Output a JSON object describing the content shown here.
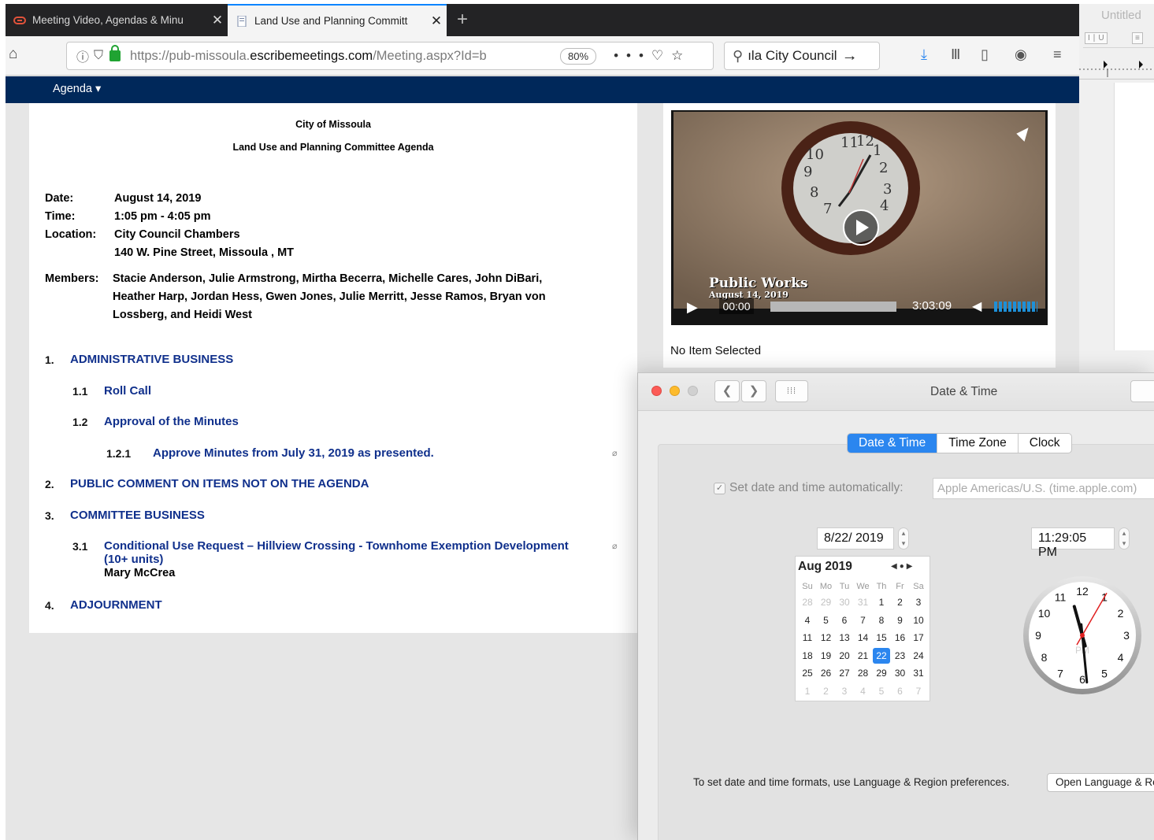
{
  "browser": {
    "tabs": [
      {
        "label": "Meeting Video, Agendas & Minu",
        "active": false
      },
      {
        "label": "Land Use and Planning Committ",
        "active": true
      }
    ],
    "url_prefix": "https://pub-missoula.",
    "url_domain": "escribemeetings.com",
    "url_suffix": "/Meeting.aspx?Id=b",
    "zoom": "80%",
    "search_text": "ıla City Council"
  },
  "site": {
    "menu_label": "Agenda ▾"
  },
  "agenda": {
    "org": "City of Missoula",
    "title": "Land Use and Planning Committee Agenda",
    "date_label": "Date:",
    "date_value": "August 14, 2019",
    "time_label": "Time:",
    "time_value": "1:05 pm - 4:05 pm",
    "location_label": "Location:",
    "location_line1": "City Council Chambers",
    "location_line2": "140 W. Pine Street, Missoula , MT",
    "members_label": "Members:",
    "members_line1": "Stacie Anderson, Julie Armstrong, Mirtha Becerra, Michelle Cares, John DiBari,",
    "members_line2": "Heather Harp, Jordan Hess, Gwen Jones, Julie Merritt, Jesse Ramos, Bryan von",
    "members_line3": "Lossberg, and Heidi West",
    "items": {
      "n1": "1.",
      "t1": "ADMINISTRATIVE BUSINESS",
      "n11": "1.1",
      "t11": "Roll Call",
      "n12": "1.2",
      "t12": "Approval of the Minutes",
      "n121": "1.2.1",
      "t121": "Approve Minutes from July 31, 2019 as presented.",
      "n2": "2.",
      "t2": "PUBLIC COMMENT ON ITEMS NOT ON THE AGENDA",
      "n3": "3.",
      "t3": "COMMITTEE BUSINESS",
      "n31": "3.1",
      "t31a": "Conditional Use Request – Hillview Crossing - Townhome Exemption Development",
      "t31b": "(10+ units)",
      "t31presenter": "Mary McCrea",
      "n4": "4.",
      "t4": "ADJOURNMENT"
    }
  },
  "video": {
    "overlay_title": "Public Works",
    "overlay_date": "August 14, 2019",
    "current_time": "00:00",
    "duration": "3:03:09",
    "progress": 0.0,
    "no_item": "No Item Selected"
  },
  "background_window": {
    "title": "Untitled"
  },
  "datetime": {
    "window_title": "Date & Time",
    "tabs": [
      "Date & Time",
      "Time Zone",
      "Clock"
    ],
    "active_tab": "Date & Time",
    "auto_label": "Set date and time automatically:",
    "auto_checked": true,
    "server": "Apple Americas/U.S. (time.apple.com)",
    "date_field": "8/22/ 2019",
    "time_field": "11:29:05 PM",
    "calendar": {
      "month_label": "Aug 2019",
      "dow": [
        "Su",
        "Mo",
        "Tu",
        "We",
        "Th",
        "Fr",
        "Sa"
      ],
      "weeks": [
        [
          "28",
          "29",
          "30",
          "31",
          "1",
          "2",
          "3"
        ],
        [
          "4",
          "5",
          "6",
          "7",
          "8",
          "9",
          "10"
        ],
        [
          "11",
          "12",
          "13",
          "14",
          "15",
          "16",
          "17"
        ],
        [
          "18",
          "19",
          "20",
          "21",
          "22",
          "23",
          "24"
        ],
        [
          "25",
          "26",
          "27",
          "28",
          "29",
          "30",
          "31"
        ],
        [
          "1",
          "2",
          "3",
          "4",
          "5",
          "6",
          "7"
        ]
      ],
      "selected_day": "22"
    },
    "clock": {
      "numbers": [
        "12",
        "1",
        "2",
        "3",
        "4",
        "5",
        "6",
        "7",
        "8",
        "9",
        "10",
        "11"
      ],
      "ampm": "PM",
      "hour": 11,
      "minute": 29,
      "second": 5
    },
    "footer_text": "To set date and time formats, use Language & Region preferences.",
    "open_button": "Open Language & Region..."
  },
  "colors": {
    "site_header": "#00285a",
    "agenda_link": "#10308c",
    "selection_blue": "#2b86ef",
    "second_hand": "#e02020"
  }
}
